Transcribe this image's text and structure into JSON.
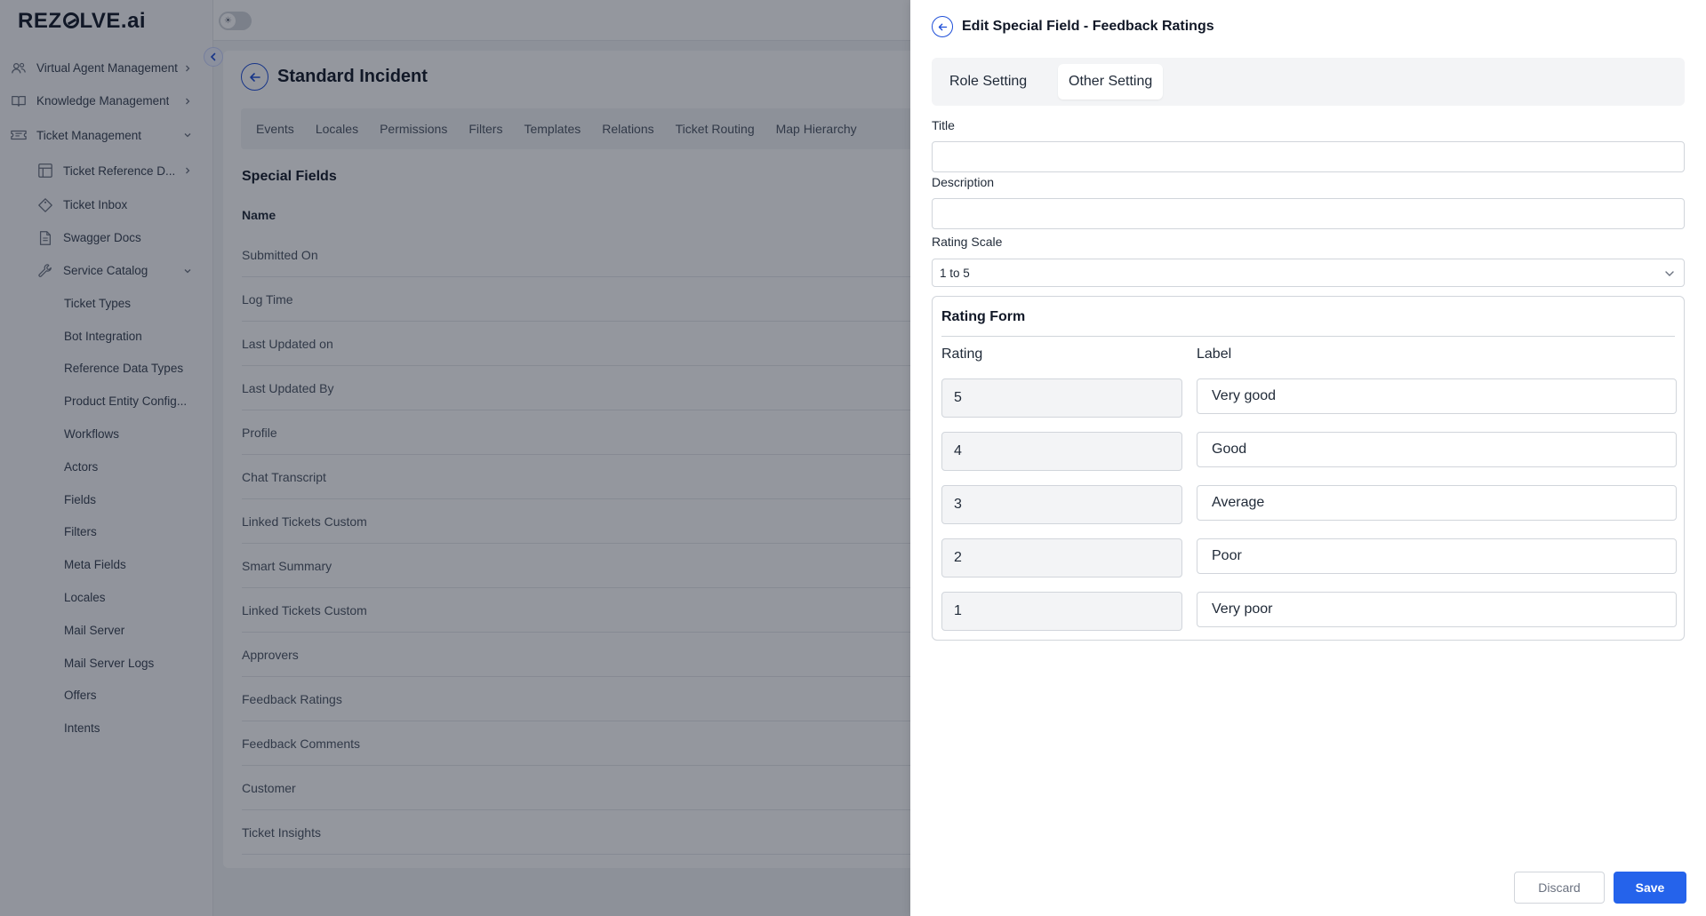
{
  "app": {
    "logo_prefix": "REZ",
    "logo_suffix": "LVE.ai"
  },
  "sidebar": {
    "items": [
      {
        "label": "Virtual Agent Management",
        "icon": "users-icon",
        "level": 0,
        "chevron": "right"
      },
      {
        "label": "Knowledge Management",
        "icon": "book-icon",
        "level": 0,
        "chevron": "right"
      },
      {
        "label": "Ticket Management",
        "icon": "ticket-icon",
        "level": 0,
        "chevron": "down"
      },
      {
        "label": "Ticket Reference D...",
        "icon": "table-icon",
        "level": 1,
        "chevron": "right"
      },
      {
        "label": "Ticket Inbox",
        "icon": "tag-icon",
        "level": 1,
        "chevron": ""
      },
      {
        "label": "Swagger Docs",
        "icon": "document-icon",
        "level": 1,
        "chevron": ""
      },
      {
        "label": "Service Catalog",
        "icon": "wrench-icon",
        "level": 1,
        "chevron": "down"
      },
      {
        "label": "Ticket Types",
        "level": 2
      },
      {
        "label": "Bot Integration",
        "level": 2
      },
      {
        "label": "Reference Data Types",
        "level": 2
      },
      {
        "label": "Product Entity Config...",
        "level": 2
      },
      {
        "label": "Workflows",
        "level": 2
      },
      {
        "label": "Actors",
        "level": 2
      },
      {
        "label": "Fields",
        "level": 2
      },
      {
        "label": "Filters",
        "level": 2
      },
      {
        "label": "Meta Fields",
        "level": 2
      },
      {
        "label": "Locales",
        "level": 2
      },
      {
        "label": "Mail Server",
        "level": 2
      },
      {
        "label": "Mail Server Logs",
        "level": 2
      },
      {
        "label": "Offers",
        "level": 2
      },
      {
        "label": "Intents",
        "level": 2
      }
    ]
  },
  "main": {
    "title": "Standard Incident",
    "tabs": [
      "Events",
      "Locales",
      "Permissions",
      "Filters",
      "Templates",
      "Relations",
      "Ticket Routing",
      "Map Hierarchy"
    ],
    "section_title": "Special Fields",
    "column_name": "Name",
    "rows": [
      "Submitted On",
      "Log Time",
      "Last Updated on",
      "Last Updated By",
      "Profile",
      "Chat Transcript",
      "Linked Tickets Custom",
      "Smart Summary",
      "Linked Tickets Custom",
      "Approvers",
      "Feedback Ratings",
      "Feedback Comments",
      "Customer",
      "Ticket Insights"
    ]
  },
  "drawer": {
    "title": "Edit Special Field - Feedback Ratings",
    "tabs": [
      {
        "label": "Role Setting",
        "active": false
      },
      {
        "label": "Other Setting",
        "active": true
      }
    ],
    "title_label": "Title",
    "title_value": "",
    "description_label": "Description",
    "description_value": "",
    "rating_scale_label": "Rating Scale",
    "rating_scale_value": "1 to 5",
    "rating_form": {
      "title": "Rating Form",
      "rating_header": "Rating",
      "label_header": "Label",
      "rows": [
        {
          "rating": "5",
          "label": "Very good"
        },
        {
          "rating": "4",
          "label": "Good"
        },
        {
          "rating": "3",
          "label": "Average"
        },
        {
          "rating": "2",
          "label": "Poor"
        },
        {
          "rating": "1",
          "label": "Very poor"
        }
      ]
    },
    "discard_label": "Discard",
    "save_label": "Save"
  },
  "colors": {
    "primary": "#2563eb",
    "overlay": "#111827"
  }
}
